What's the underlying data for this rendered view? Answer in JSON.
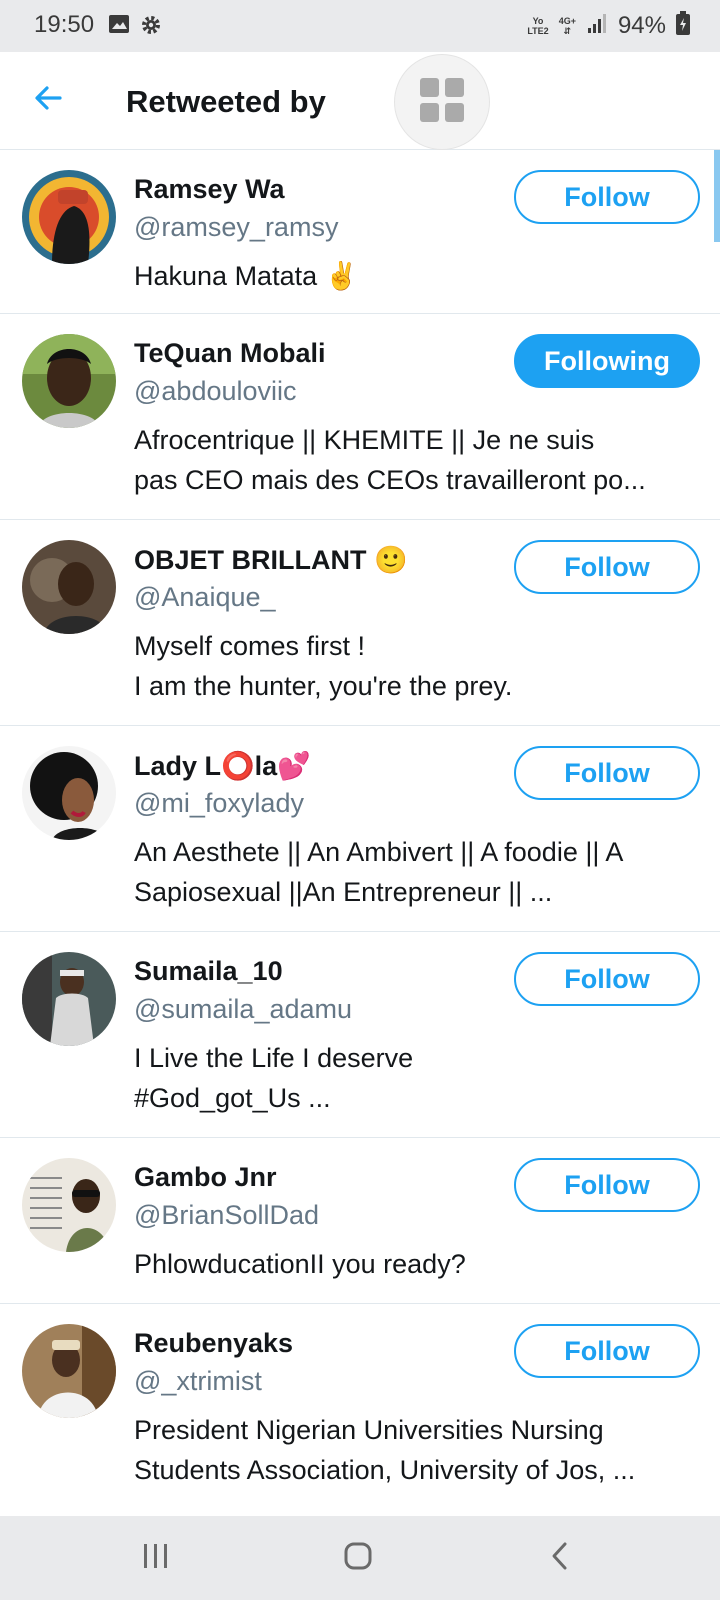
{
  "status_bar": {
    "time": "19:50",
    "network_top": "Yo",
    "network_bottom": "LTE2",
    "network_type": "4G+",
    "battery": "94%"
  },
  "header": {
    "title": "Retweeted by",
    "back_icon": "arrow-left-icon",
    "grid_icon": "grid-icon"
  },
  "colors": {
    "accent": "#1da1f2",
    "handle": "#657786",
    "text": "#14171a",
    "divider": "#e1e8ed"
  },
  "users": [
    {
      "name": "Ramsey Wa",
      "handle": "@ramsey_ramsy",
      "bio_lines": [
        "Hakuna Matata ✌️"
      ],
      "button": "Follow",
      "following": false
    },
    {
      "name": "TeQuan Mobali",
      "handle": "@abdouloviic",
      "bio_lines": [
        "Afrocentrique || KHEMITE || Je ne suis",
        "pas CEO mais des CEOs travailleront po..."
      ],
      "button": "Following",
      "following": true
    },
    {
      "name": "OBJET BRILLANT 🙂",
      "handle": "@Anaique_",
      "bio_lines": [
        "Myself comes first !",
        "I am the hunter, you're the prey."
      ],
      "button": "Follow",
      "following": false
    },
    {
      "name": "Lady L⭕la💕",
      "handle": "@mi_foxylady",
      "bio_lines": [
        "An Aesthete || An Ambivert || A foodie || A",
        "Sapiosexual ||An Entrepreneur || ..."
      ],
      "button": "Follow",
      "following": false
    },
    {
      "name": "Sumaila_10",
      "handle": "@sumaila_adamu",
      "bio_lines": [
        "I Live the Life I deserve",
        "#God_got_Us ..."
      ],
      "button": "Follow",
      "following": false
    },
    {
      "name": "Gambo Jnr",
      "handle": "@BrianSollDad",
      "bio_lines": [
        "PhlowducationII you ready?"
      ],
      "button": "Follow",
      "following": false
    },
    {
      "name": "Reubenyaks",
      "handle": "@_xtrimist",
      "bio_lines": [
        "President Nigerian Universities Nursing",
        "Students Association, University of Jos, ..."
      ],
      "button": "Follow",
      "following": false
    }
  ],
  "nav": {
    "recents_icon": "recents-icon",
    "home_icon": "home-icon",
    "back_icon": "back-chevron-icon"
  }
}
